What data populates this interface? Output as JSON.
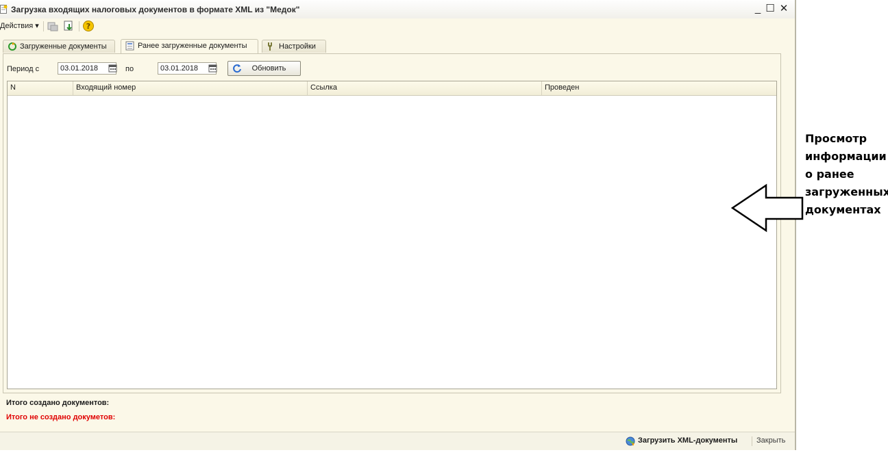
{
  "window": {
    "title": "Загрузка входящих налоговых документов в формате XML из \"Медок\"",
    "minimize": "_",
    "maximize": "☐",
    "close": "✕"
  },
  "toolbar": {
    "actions_label": "Действия ▾"
  },
  "tabs": [
    {
      "label": "Загруженные документы",
      "icon": "recycle-icon",
      "active": false
    },
    {
      "label": "Ранее загруженные документы",
      "icon": "document-list-icon",
      "active": true
    },
    {
      "label": "Настройки",
      "icon": "wrench-icon",
      "active": false
    }
  ],
  "filter": {
    "period_from_label": "Период с",
    "date_from": "03.01.2018",
    "to_label": "по",
    "date_to": "03.01.2018",
    "refresh_label": "Обновить"
  },
  "table": {
    "columns": [
      "N",
      "Входящий номер",
      "Ссылка",
      "Проведен"
    ],
    "rows": []
  },
  "totals": {
    "created_label": "Итого создано документов:",
    "not_created_label": "Итого не создано докуметов:",
    "not_created_color": "#e00000"
  },
  "bottom": {
    "load_label": "Загрузить XML-документы",
    "close_label": "Закрыть"
  },
  "annotation": {
    "lines": [
      "Просмотр",
      "информации",
      "о ранее",
      "загруженных",
      "документах"
    ]
  }
}
